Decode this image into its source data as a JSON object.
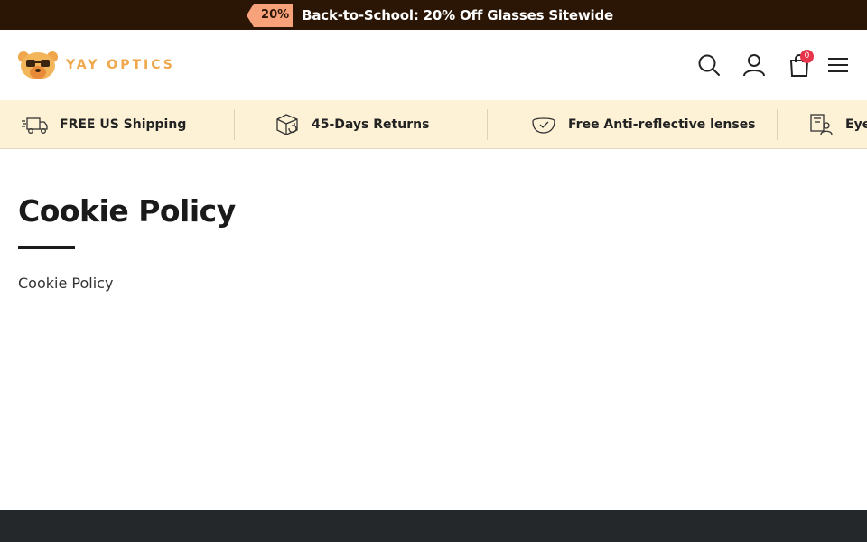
{
  "announcement": {
    "badge": "20%",
    "text": "Back-to-School: 20% Off Glasses Sitewide"
  },
  "header": {
    "brand": "YAY OPTICS",
    "logo_icon": "bear-glasses-logo",
    "cart_count": "0",
    "icons": [
      "search-icon",
      "account-icon",
      "shopping-bag-icon",
      "menu-icon"
    ]
  },
  "usp": {
    "items": [
      {
        "icon": "delivery-truck-icon",
        "label": "FREE US Shipping"
      },
      {
        "icon": "return-box-icon",
        "label": "45-Days Returns"
      },
      {
        "icon": "lens-icon",
        "label": "Free Anti-reflective lenses"
      },
      {
        "icon": "eye-exam-icon",
        "label": "Eye"
      }
    ]
  },
  "page": {
    "title": "Cookie Policy",
    "body": "Cookie Policy"
  },
  "colors": {
    "announce_bg": "#2b1605",
    "badge_bg": "#f7a27a",
    "brand": "#f0a64a",
    "usp_bg": "#fdf2d6",
    "cart_badge": "#e8344a",
    "footer_bg": "#25282b"
  }
}
